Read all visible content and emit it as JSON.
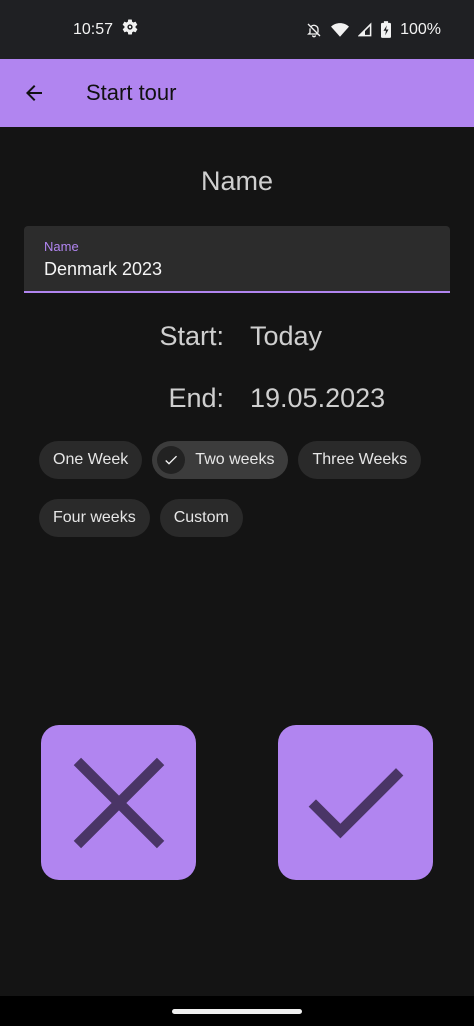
{
  "status_bar": {
    "time": "10:57",
    "battery": "100%",
    "icons": [
      "settings-icon",
      "notifications-off-icon",
      "wifi-icon",
      "signal-icon",
      "battery-charging-icon"
    ]
  },
  "app_bar": {
    "title": "Start tour",
    "back_icon": "arrow-back-icon",
    "color": "#b185f0"
  },
  "form": {
    "heading": "Name",
    "name_field": {
      "label": "Name",
      "value": "Denmark 2023"
    },
    "start": {
      "label": "Start:",
      "value": "Today"
    },
    "end": {
      "label": "End:",
      "value": "19.05.2023"
    }
  },
  "duration_chips": [
    {
      "label": "One Week",
      "selected": false
    },
    {
      "label": "Two weeks",
      "selected": true
    },
    {
      "label": "Three Weeks",
      "selected": false
    },
    {
      "label": "Four weeks",
      "selected": false
    },
    {
      "label": "Custom",
      "selected": false
    }
  ],
  "actions": {
    "cancel_icon": "close-icon",
    "confirm_icon": "check-icon",
    "button_color": "#b185f0",
    "icon_color": "#4a3566"
  }
}
